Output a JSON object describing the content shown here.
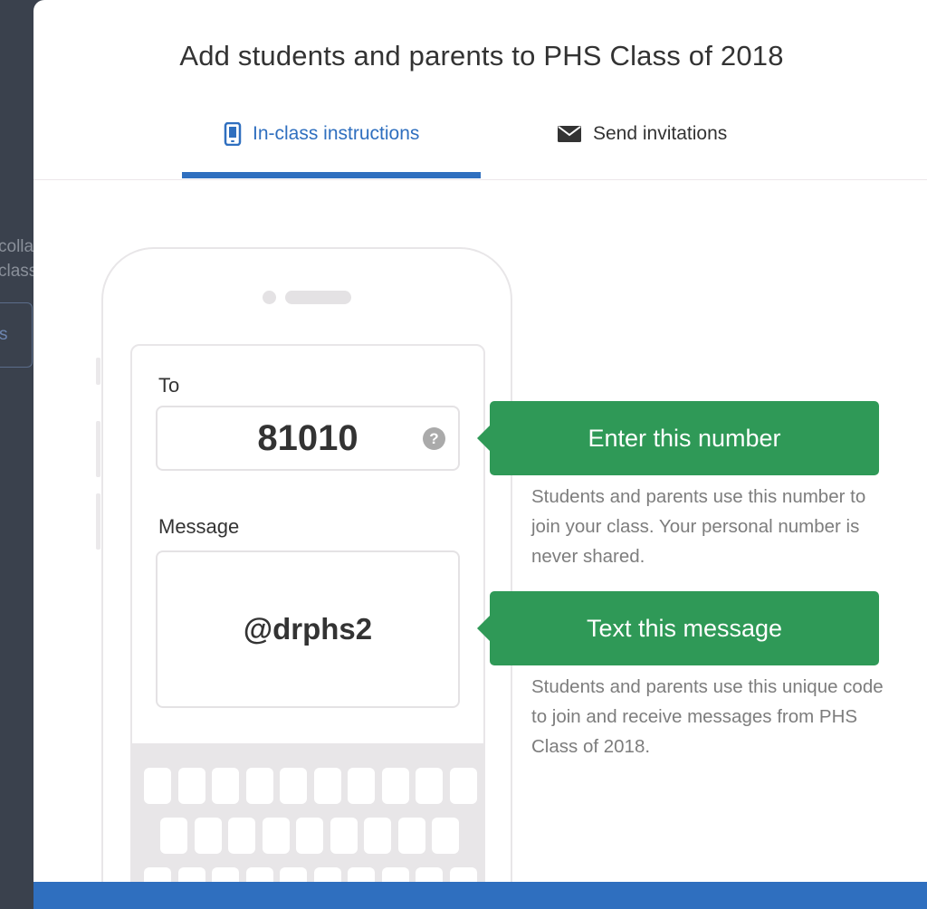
{
  "background": {
    "line1": "colla",
    "line2": "class",
    "button_text": "s"
  },
  "modal": {
    "title": "Add students and parents to PHS Class of 2018"
  },
  "tabs": [
    {
      "label": "In-class instructions",
      "icon": "phone-icon",
      "active": true
    },
    {
      "label": "Send invitations",
      "icon": "envelope-icon",
      "active": false
    }
  ],
  "phone": {
    "to_label": "To",
    "to_value": "81010",
    "help_glyph": "?",
    "message_label": "Message",
    "message_value": "@drphs2"
  },
  "callouts": [
    {
      "title": "Enter this number",
      "description": "Students and parents use this number to join your class. Your personal number is never shared."
    },
    {
      "title": "Text this message",
      "description": "Students and parents use this unique code to join and receive messages from PHS Class of 2018."
    }
  ],
  "colors": {
    "accent_blue": "#2f6fbf",
    "callout_green": "#2f9957",
    "overlay": "#3a414d"
  }
}
